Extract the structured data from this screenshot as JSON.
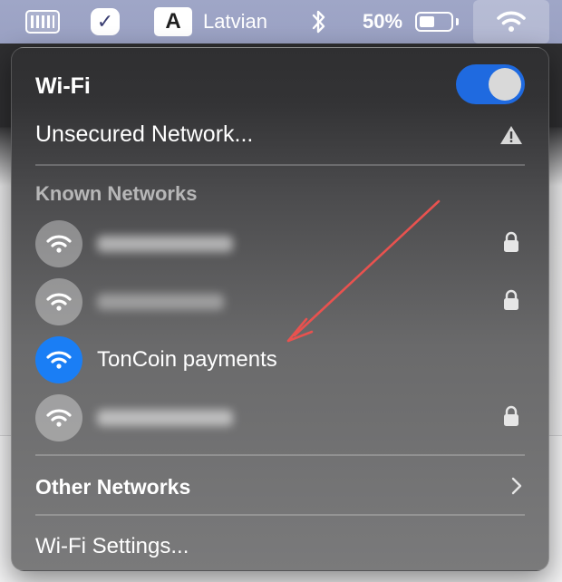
{
  "menubar": {
    "input_source_badge": "A",
    "input_source_label": "Latvian",
    "battery_percent": "50%",
    "battery_level": 0.5
  },
  "wifi": {
    "title": "Wi-Fi",
    "enabled": true,
    "unsecured_label": "Unsecured Network...",
    "known_networks_label": "Known Networks",
    "networks": [
      {
        "name": "",
        "redacted": true,
        "locked": true,
        "active": false
      },
      {
        "name": "",
        "redacted": true,
        "locked": true,
        "active": false
      },
      {
        "name": "TonCoin payments",
        "redacted": false,
        "locked": false,
        "active": true
      },
      {
        "name": "",
        "redacted": true,
        "locked": true,
        "active": false
      }
    ],
    "other_networks_label": "Other Networks",
    "settings_label": "Wi-Fi Settings..."
  },
  "colors": {
    "accent": "#1a7ef5",
    "toggle_on": "#1f6ae0",
    "annotation_arrow": "#e8524f"
  }
}
